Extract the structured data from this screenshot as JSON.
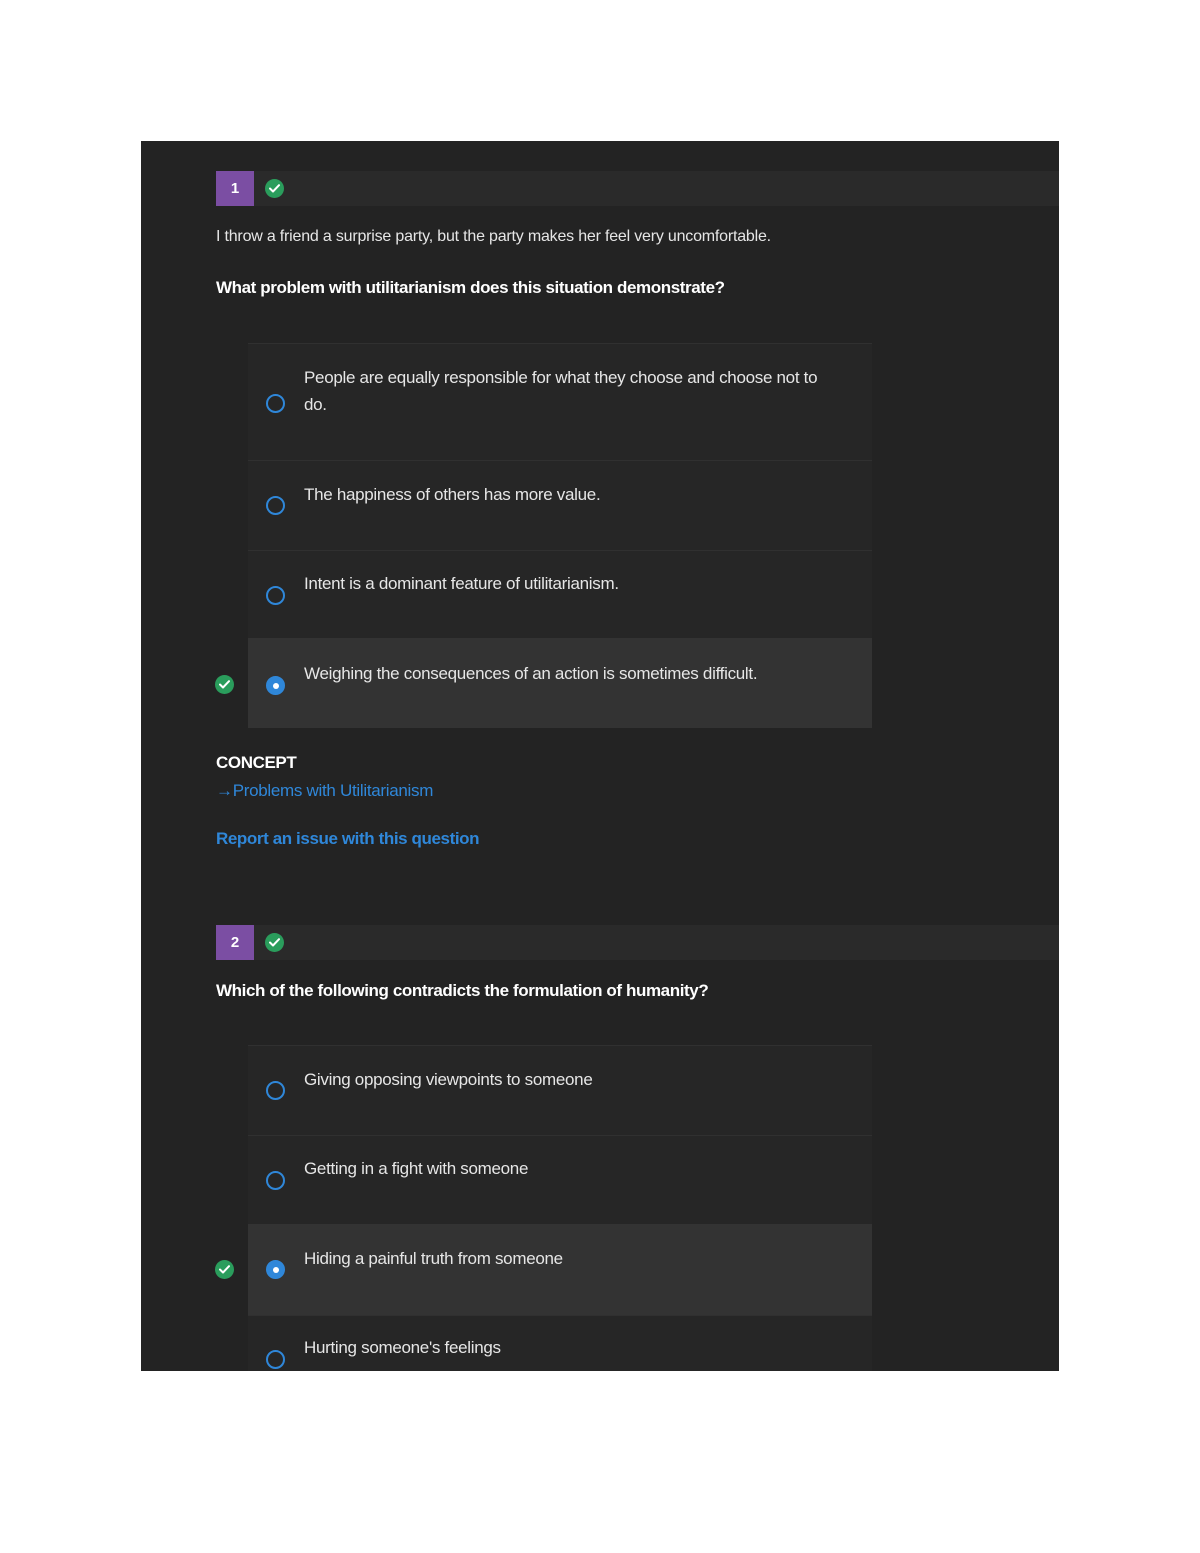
{
  "questions": [
    {
      "number": "1",
      "scenario": "I throw a friend a surprise party, but the party makes her feel very uncomfortable.",
      "prompt": "What problem with utilitarianism does this situation demonstrate?",
      "options": [
        {
          "text": "People are equally responsible for what they choose and choose not to do.",
          "selected": false
        },
        {
          "text": "The happiness of others has more value.",
          "selected": false
        },
        {
          "text": "Intent is a dominant feature of utilitarianism.",
          "selected": false
        },
        {
          "text": "Weighing the consequences of an action is sometimes difficult.",
          "selected": true
        }
      ],
      "concept_label": "CONCEPT",
      "concept_arrow": "→",
      "concept_link": "Problems with Utilitarianism",
      "report_link": "Report an issue with this question"
    },
    {
      "number": "2",
      "prompt": "Which of the following contradicts the formulation of humanity?",
      "options": [
        {
          "text": "Giving opposing viewpoints to someone",
          "selected": false
        },
        {
          "text": "Getting in a fight with someone",
          "selected": false
        },
        {
          "text": "Hiding a painful truth from someone",
          "selected": true
        },
        {
          "text": "Hurting someone's feelings",
          "selected": false
        }
      ]
    }
  ],
  "colors": {
    "background": "#232323",
    "question_badge": "#7b4ea3",
    "correct_check": "#2a9d5c",
    "accent_blue": "#2f87d9",
    "selected_option_bg": "#333333"
  },
  "icons": {
    "correct": "check-circle-icon",
    "radio_empty": "radio-unselected-icon",
    "radio_filled": "radio-selected-icon",
    "arrow": "arrow-right-icon"
  }
}
